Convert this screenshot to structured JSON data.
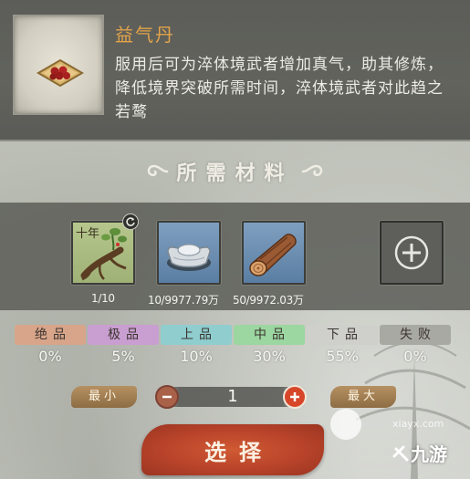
{
  "item": {
    "name": "益气丹",
    "description": "服用后可为淬体境武者增加真气，助其修炼，降低境界突破所需时间，淬体境武者对此趋之若鹜",
    "icon": "pill-plate-icon"
  },
  "materials_section": {
    "title": "所需材料",
    "slots": [
      {
        "icon": "herb-root-icon",
        "tag": "十年",
        "count": "1/10",
        "bg": "#a8ba80"
      },
      {
        "icon": "silver-ingot-icon",
        "count": "10/9977.79万",
        "bg": "#6b8db1"
      },
      {
        "icon": "wood-log-icon",
        "count": "50/9972.03万",
        "bg": "#6b8db1"
      },
      {
        "icon": "plus-icon",
        "count": ""
      }
    ]
  },
  "grades": [
    {
      "label": "绝品",
      "value": "0%",
      "color": "#d8a58a"
    },
    {
      "label": "极品",
      "value": "5%",
      "color": "#c99ed0"
    },
    {
      "label": "上品",
      "value": "10%",
      "color": "#8fcdcf"
    },
    {
      "label": "中品",
      "value": "30%",
      "color": "#9cd6a0"
    },
    {
      "label": "下品",
      "value": "55%",
      "color": "#cfd0cc"
    },
    {
      "label": "失败",
      "value": "0%",
      "color": "#a9a9a4"
    }
  ],
  "quantity": {
    "min_label": "最小",
    "max_label": "最大",
    "value": "1"
  },
  "select_button": {
    "label": "选择"
  },
  "watermark": {
    "url": "xiayx.com",
    "logo": "九游"
  },
  "colors": {
    "accent_red": "#c44a2c",
    "gold_title": "#e3a34a"
  }
}
